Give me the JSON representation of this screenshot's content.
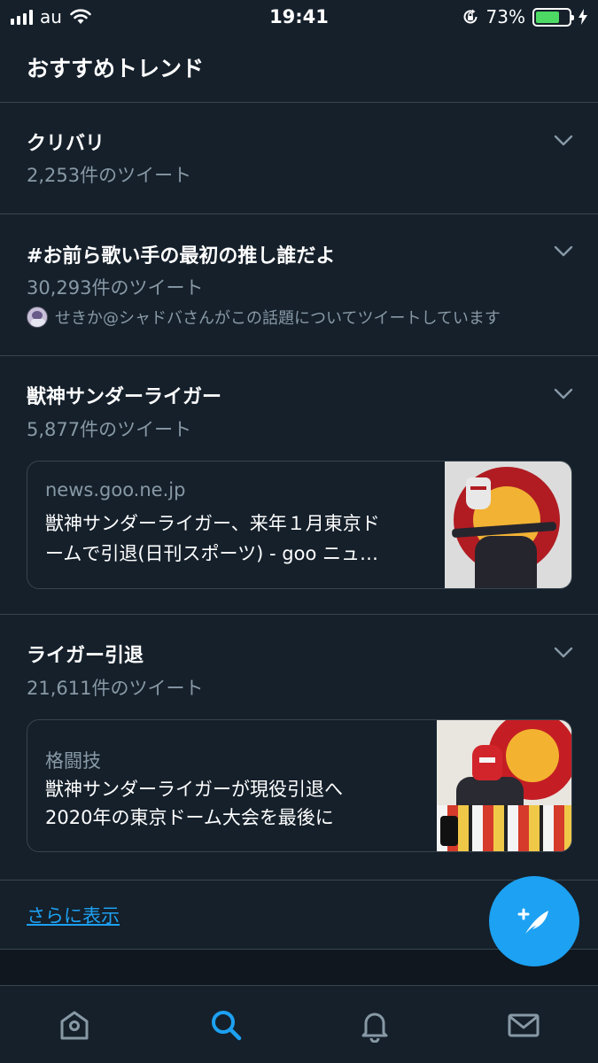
{
  "status_bar": {
    "carrier": "au",
    "time": "19:41",
    "battery_percent": "73%",
    "battery_level": 0.73,
    "icons": [
      "signal-icon",
      "wifi-icon",
      "rotation-lock-icon",
      "battery-icon",
      "charging-bolt-icon"
    ]
  },
  "header": {
    "title": "おすすめトレンド"
  },
  "trends": [
    {
      "name": "クリバリ",
      "count": "2,253件のツイート"
    },
    {
      "name": "#お前ら歌い手の最初の推し誰だよ",
      "count": "30,293件のツイート",
      "context": "せきか@シャドバさんがこの話題についてツイートしています"
    },
    {
      "name": "獣神サンダーライガー",
      "count": "5,877件のツイート",
      "card": {
        "source": "news.goo.ne.jp",
        "text_line1": "獣神サンダーライガー、来年１月東京ド",
        "text_line2": "ームで引退(日刊スポーツ) - goo ニュ…"
      }
    },
    {
      "name": "ライガー引退",
      "count": "21,611件のツイート",
      "card": {
        "source": "格闘技",
        "text_line1": "獣神サンダーライガーが現役引退へ",
        "text_line2": "2020年の東京ドーム大会を最後に"
      }
    }
  ],
  "show_more": "さらに表示",
  "tab_bar": {
    "tabs": [
      "home-icon",
      "search-icon",
      "notifications-icon",
      "messages-icon"
    ],
    "active": "search-icon"
  },
  "colors": {
    "background": "#15202b",
    "divider": "#38444d",
    "secondary_text": "#8899a6",
    "accent": "#1da1f2",
    "battery": "#4cd964"
  }
}
